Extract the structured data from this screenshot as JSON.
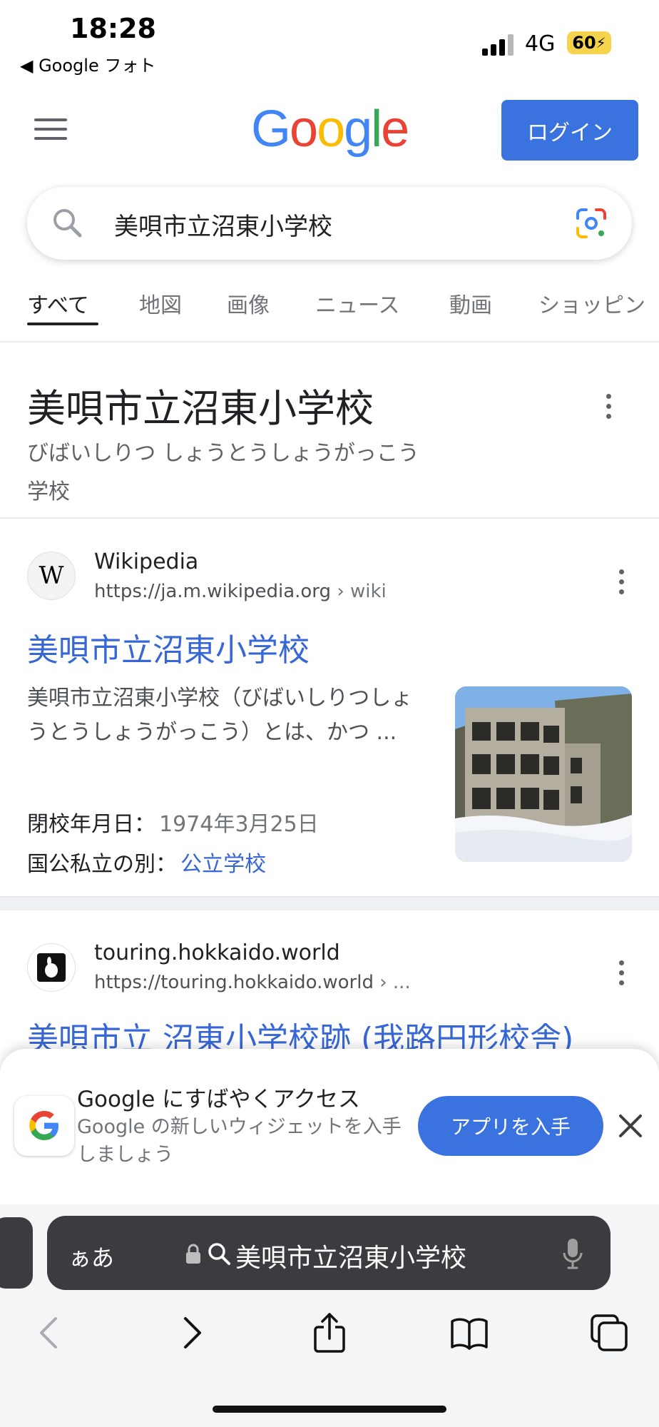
{
  "status_bar": {
    "time": "18:28",
    "back_app": "◀ Google フォト",
    "network": "4G",
    "battery": "60"
  },
  "header": {
    "logo": [
      "G",
      "o",
      "o",
      "g",
      "l",
      "e"
    ],
    "logo_colors": [
      "#4285F4",
      "#EA4335",
      "#FBBC05",
      "#4285F4",
      "#34A853",
      "#EA4335"
    ],
    "login_label": "ログイン"
  },
  "search": {
    "query": "美唄市立沼東小学校"
  },
  "tabs": [
    {
      "label": "すべて"
    },
    {
      "label": "地図"
    },
    {
      "label": "画像"
    },
    {
      "label": "ニュース"
    },
    {
      "label": "動画"
    },
    {
      "label": "ショッピン"
    }
  ],
  "knowledge": {
    "title": "美唄市立沼東小学校",
    "reading": "びばいしりつ しょうとうしょうがっこう",
    "type": "学校"
  },
  "results": [
    {
      "favicon_text": "W",
      "site_name": "Wikipedia",
      "url": "https://ja.m.wikipedia.org",
      "url_path": "› wiki",
      "title": "美唄市立沼東小学校",
      "snippet": "美唄市立沼東小学校（びばいしりつしょうとうしょうがっこう）とは、かつ ...",
      "facts": [
        {
          "label": "閉校年月日：",
          "value": "1974年3月25日"
        },
        {
          "label": "国公私立の別：",
          "value": "公立学校"
        }
      ]
    },
    {
      "site_name": "touring.hokkaido.world",
      "url": "https://touring.hokkaido.world",
      "url_path": "› ...",
      "title": "美唄市立 沼東小学校跡 (我路円形校舎)"
    }
  ],
  "banner": {
    "title": "Google にすばやくアクセス",
    "subtitle": "Google の新しいウィジェットを入手しましょう",
    "get_app_label": "アプリを入手"
  },
  "browser": {
    "aa_label": "ぁあ",
    "url_text": "美唄市立沼東小学校"
  }
}
